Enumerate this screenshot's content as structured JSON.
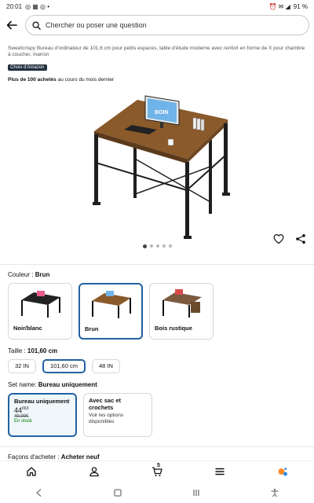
{
  "status_bar": {
    "time": "20:01",
    "left_icons": "◎ ▦ ◎ •",
    "right_icons": "⏰ ✉ ◢",
    "battery": "91 %"
  },
  "search": {
    "placeholder": "Chercher ou poser une question"
  },
  "product": {
    "title": "Sweetcrispy Bureau d'ordinateur de 101,6 cm pour petits espaces, table d'étude moderne avec renfort en forme de X pour chambre à coucher, marron",
    "badge": "Choix d'Amazon",
    "sales_strong": "Plus de 100 achetés",
    "sales_rest": " au cours du mois dernier",
    "monitor_text": "BOIN"
  },
  "carousel": {
    "count": 5,
    "active_index": 0
  },
  "color": {
    "label": "Couleur : ",
    "value": "Brun",
    "options": [
      {
        "name": "Noir/blanc",
        "selected": false
      },
      {
        "name": "Brun",
        "selected": true
      },
      {
        "name": "Bois rustique",
        "selected": false
      }
    ]
  },
  "size": {
    "label": "Taille : ",
    "value": "101,60 cm",
    "options": [
      {
        "label": "32 IN",
        "selected": false
      },
      {
        "label": "101,60 cm",
        "selected": true
      },
      {
        "label": "48 IN",
        "selected": false
      }
    ]
  },
  "set": {
    "label": "Set name: ",
    "value": "Bureau uniquement",
    "option1": {
      "title": "Bureau uniquement",
      "price_main": "44",
      "price_sup": "€63",
      "old_price": "49,99€",
      "stock": "En stock"
    },
    "option2": {
      "title": "Avec sac et crochets",
      "sub": "Voir les options disponibles"
    }
  },
  "purchase": {
    "label": "Façons d'acheter : ",
    "value": "Acheter neuf"
  },
  "bottom_nav": {
    "cart_count": "5"
  },
  "colors": {
    "accent": "#2162a1",
    "badge_bg": "#232f3e",
    "desk_top": "#8a5a2b",
    "desk_frame": "#1e1e1e"
  }
}
